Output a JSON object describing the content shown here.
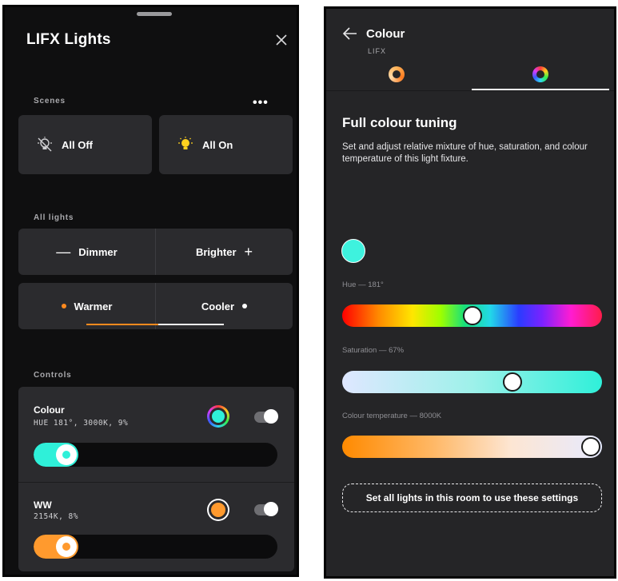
{
  "left": {
    "title": "LIFX Lights",
    "scenes": {
      "label": "Scenes",
      "more_label": "•••",
      "items": [
        {
          "label": "All Off",
          "icon": "bulb-off-icon"
        },
        {
          "label": "All On",
          "icon": "bulb-on-icon"
        }
      ]
    },
    "all_lights": {
      "label": "All lights",
      "dimmer_label": "Dimmer",
      "dimmer_glyph": "—",
      "brighter_label": "Brighter",
      "brighter_glyph": "+",
      "warmer_label": "Warmer",
      "cooler_label": "Cooler"
    },
    "controls": {
      "label": "Controls",
      "items": [
        {
          "name": "Colour",
          "meta": "HUE 181°, 3000K, 9%",
          "on": true,
          "level_fraction": 0.09,
          "color": "#2ff0d9"
        },
        {
          "name": "WW",
          "meta": "2154K, 8%",
          "on": true,
          "level_fraction": 0.08,
          "color": "#ff9a2e"
        }
      ]
    }
  },
  "right": {
    "title": "Colour",
    "subtitle": "LIFX",
    "tabs": [
      {
        "icon": "warm-ring-icon",
        "active": false
      },
      {
        "icon": "colour-wheel-icon",
        "active": true
      }
    ],
    "heading": "Full colour tuning",
    "description": "Set and adjust relative mixture of hue, saturation, and colour temperature of this light fixture.",
    "preview_color": "#3ef2de",
    "hue": {
      "label": "Hue — 181°",
      "value_fraction": 0.503
    },
    "saturation": {
      "label": "Saturation — 67%",
      "value_fraction": 0.67
    },
    "temperature": {
      "label": "Colour temperature — 8000K",
      "value_fraction": 1.0
    },
    "apply_label": "Set all lights in this room to use these settings"
  },
  "colors": {
    "accent_orange": "#ff8a1e",
    "teal": "#2ff0d9",
    "card_bg": "#2b2b2e"
  }
}
